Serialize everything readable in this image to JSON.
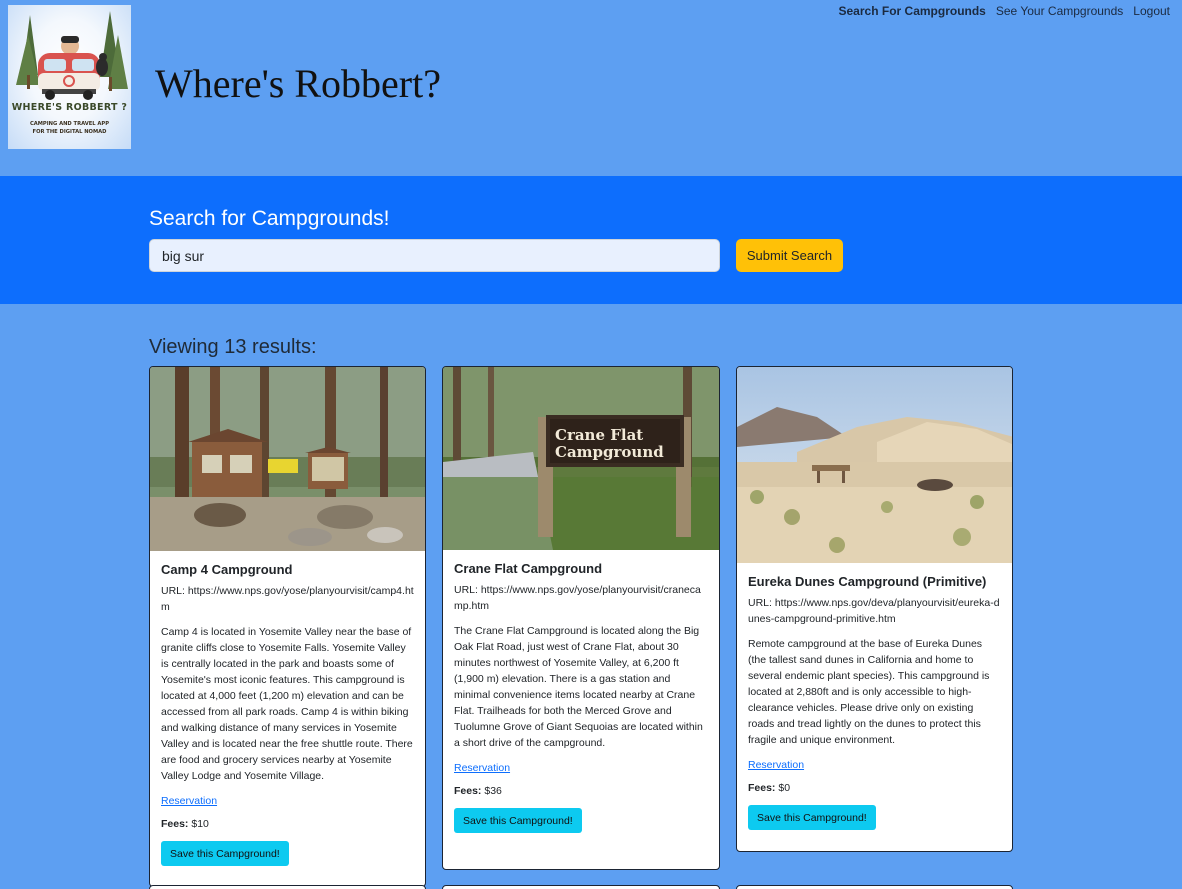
{
  "header": {
    "logo_title": "WHERE'S ROBBERT ?",
    "logo_sub1": "CAMPING AND TRAVEL APP",
    "logo_sub2": "FOR THE DIGITAL NOMAD",
    "site_title": "Where's Robbert?"
  },
  "nav": {
    "items": [
      {
        "label": "Search For Campgrounds",
        "active": true
      },
      {
        "label": "See Your Campgrounds",
        "active": false
      },
      {
        "label": "Logout",
        "active": false
      }
    ]
  },
  "search": {
    "heading": "Search for Campgrounds!",
    "value": "big sur",
    "button_label": "Submit Search"
  },
  "results": {
    "count_text": "Viewing 13 results:"
  },
  "cards": [
    {
      "title": "Camp 4 Campground",
      "url_text": "URL: https://www.nps.gov/yose/planyourvisit/camp4.htm",
      "image_sign": "",
      "description": "Camp 4 is located in Yosemite Valley near the base of granite cliffs close to Yosemite Falls. Yosemite Valley is centrally located in the park and boasts some of Yosemite's most iconic features. This campground is located at 4,000 feet (1,200 m) elevation and can be accessed from all park roads. Camp 4 is within biking and walking distance of many services in Yosemite Valley and is located near the free shuttle route. There are food and grocery services nearby at Yosemite Valley Lodge and Yosemite Village.",
      "reservation_label": "Reservation",
      "fees_label": "Fees:",
      "fees_value": "$10",
      "save_label": "Save this Campground!"
    },
    {
      "title": "Crane Flat Campground",
      "url_text": "URL: https://www.nps.gov/yose/planyourvisit/cranecamp.htm",
      "image_sign_line1": "Crane Flat",
      "image_sign_line2": "Campground",
      "description": "The Crane Flat Campground is located along the Big Oak Flat Road, just west of Crane Flat, about 30 minutes northwest of Yosemite Valley, at 6,200 ft (1,900 m) elevation. There is a gas station and minimal convenience items located nearby at Crane Flat. Trailheads for both the Merced Grove and Tuolumne Grove of Giant Sequoias are located within a short drive of the campground.",
      "reservation_label": "Reservation",
      "fees_label": "Fees:",
      "fees_value": "$36",
      "save_label": "Save this Campground!"
    },
    {
      "title": "Eureka Dunes Campground (Primitive)",
      "url_text": "URL: https://www.nps.gov/deva/planyourvisit/eureka-dunes-campground-primitive.htm",
      "description": "Remote campground at the base of Eureka Dunes (the tallest sand dunes in California and home to several endemic plant species). This campground is located at 2,880ft and is only accessible to high-clearance vehicles. Please drive only on existing roads and tread lightly on the dunes to protect this fragile and unique environment.",
      "reservation_label": "Reservation",
      "fees_label": "Fees:",
      "fees_value": "$0",
      "save_label": "Save this Campground!"
    }
  ]
}
